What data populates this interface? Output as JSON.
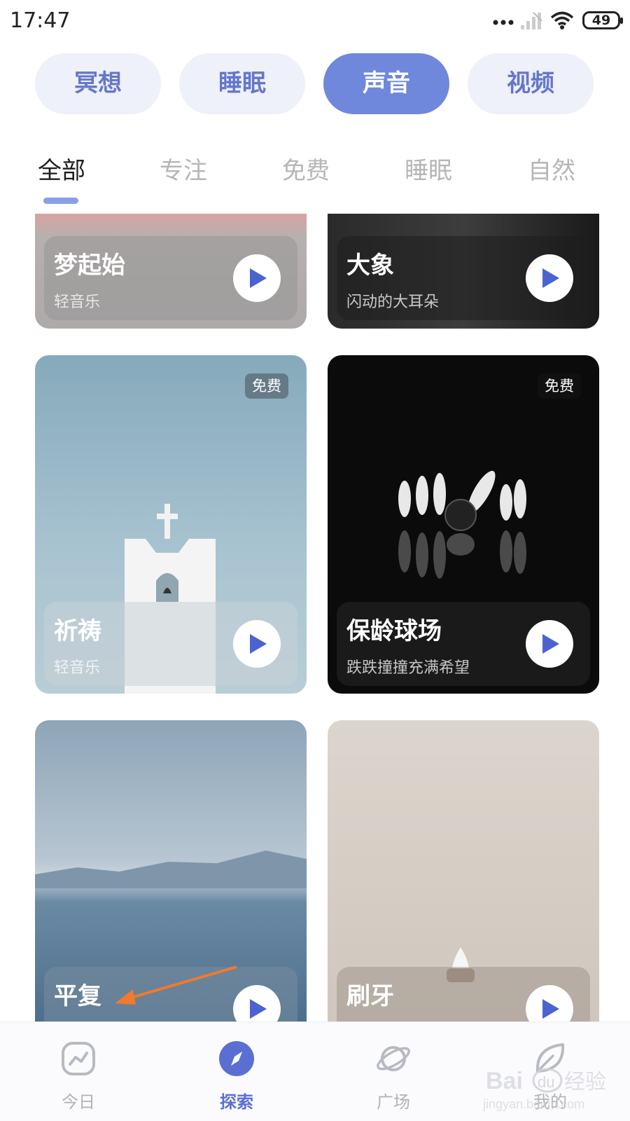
{
  "status_bar": {
    "time": "17:47",
    "battery": "49",
    "icons": [
      "more-dots-icon",
      "signal-icon",
      "wifi-icon",
      "battery-icon"
    ]
  },
  "categories": [
    {
      "label": "冥想",
      "active": false
    },
    {
      "label": "睡眠",
      "active": false
    },
    {
      "label": "声音",
      "active": true
    },
    {
      "label": "视频",
      "active": false
    }
  ],
  "sub_tabs": [
    {
      "label": "全部",
      "active": true
    },
    {
      "label": "专注",
      "active": false
    },
    {
      "label": "免费",
      "active": false
    },
    {
      "label": "睡眠",
      "active": false
    },
    {
      "label": "自然",
      "active": false
    }
  ],
  "cards": [
    {
      "title": "梦起始",
      "subtitle": "轻音乐",
      "badge": ""
    },
    {
      "title": "大象",
      "subtitle": "闪动的大耳朵",
      "badge": ""
    },
    {
      "title": "祈祷",
      "subtitle": "轻音乐",
      "badge": "免费"
    },
    {
      "title": "保龄球场",
      "subtitle": "跌跌撞撞充满希望",
      "badge": "免费"
    },
    {
      "title": "平复",
      "subtitle": "",
      "badge": ""
    },
    {
      "title": "刷牙",
      "subtitle": "",
      "badge": ""
    }
  ],
  "bottom_nav": [
    {
      "label": "今日",
      "icon": "trend-chart-icon",
      "active": false
    },
    {
      "label": "探索",
      "icon": "compass-icon",
      "active": true
    },
    {
      "label": "广场",
      "icon": "planet-icon",
      "active": false
    },
    {
      "label": "我的",
      "icon": "leaf-icon",
      "active": false
    }
  ],
  "watermark": {
    "brand": "Baidu经验",
    "url": "jingyan.baidu.com"
  },
  "colors": {
    "accent": "#6f88dc",
    "pill_bg": "#eef0fa",
    "pill_text": "#6677c9",
    "play_icon": "#4b63cf",
    "annotation_arrow": "#f07a2e"
  }
}
